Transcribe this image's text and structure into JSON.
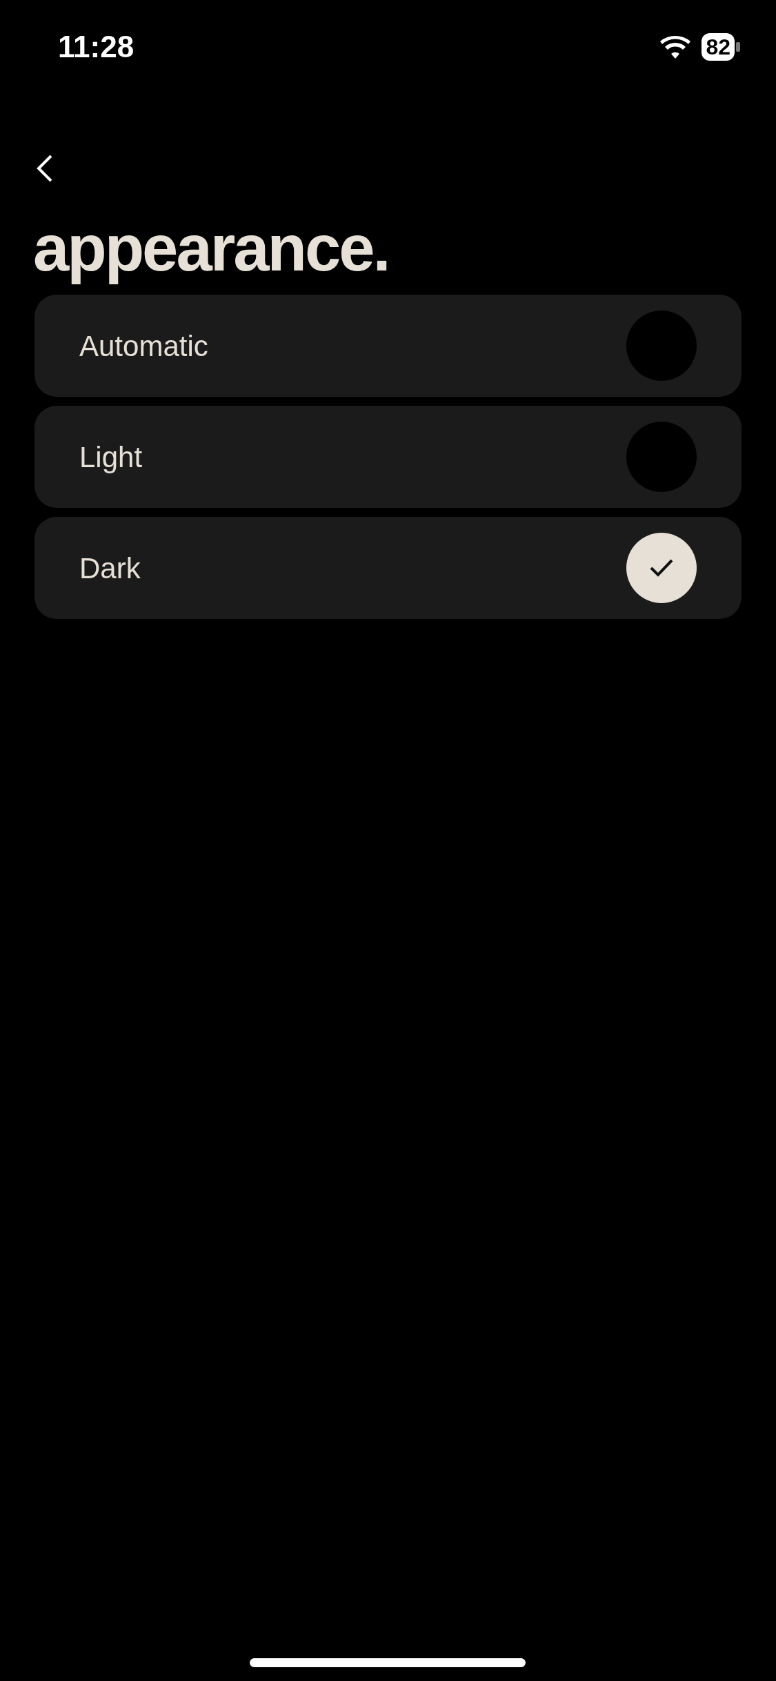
{
  "status_bar": {
    "time": "11:28",
    "battery": "82"
  },
  "title": "appearance.",
  "options": [
    {
      "label": "Automatic",
      "selected": false
    },
    {
      "label": "Light",
      "selected": false
    },
    {
      "label": "Dark",
      "selected": true
    }
  ]
}
